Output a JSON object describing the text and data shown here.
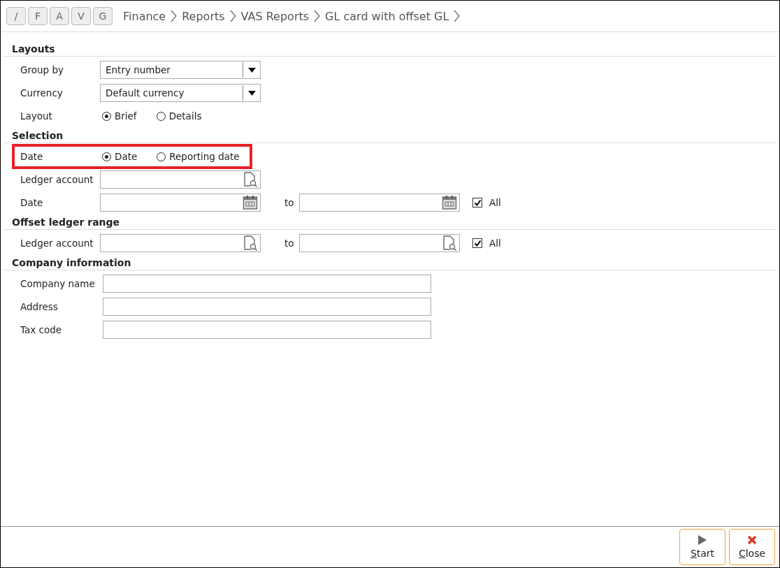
{
  "toolbar": {
    "shortcut_buttons": [
      "/",
      "F",
      "A",
      "V",
      "G"
    ],
    "breadcrumb": [
      "Finance",
      "Reports",
      "VAS Reports",
      "GL card with offset GL"
    ]
  },
  "sections": [
    {
      "title": "Layouts",
      "rows": [
        {
          "kind": "select",
          "label": "Group by",
          "value": "Entry number"
        },
        {
          "kind": "select",
          "label": "Currency",
          "value": "Default currency"
        },
        {
          "kind": "radio",
          "label": "Layout",
          "highlighted": false,
          "options": [
            {
              "label": "Brief",
              "selected": true
            },
            {
              "label": "Details",
              "selected": false
            }
          ]
        }
      ]
    },
    {
      "title": "Selection",
      "rows": [
        {
          "kind": "radio",
          "label": "Date",
          "highlighted": true,
          "options": [
            {
              "label": "Date",
              "selected": true
            },
            {
              "label": "Reporting date",
              "selected": false
            }
          ]
        },
        {
          "kind": "lookup",
          "label": "Ledger account"
        },
        {
          "kind": "date-range",
          "label": "Date",
          "to_label": "to",
          "all_label": "All",
          "all_checked": true
        }
      ]
    },
    {
      "title": "Offset ledger range",
      "rows": [
        {
          "kind": "lookup-range",
          "label": "Ledger account",
          "to_label": "to",
          "all_label": "All",
          "all_checked": true
        }
      ]
    },
    {
      "title": "Company information",
      "rows": [
        {
          "kind": "text",
          "label": "Company name"
        },
        {
          "kind": "text",
          "label": "Address"
        },
        {
          "kind": "text",
          "label": "Tax code"
        }
      ]
    }
  ],
  "footer_buttons": [
    {
      "kind": "start",
      "mnemonic": "S",
      "rest": "tart"
    },
    {
      "kind": "close",
      "mnemonic": "C",
      "rest": "lose"
    }
  ]
}
